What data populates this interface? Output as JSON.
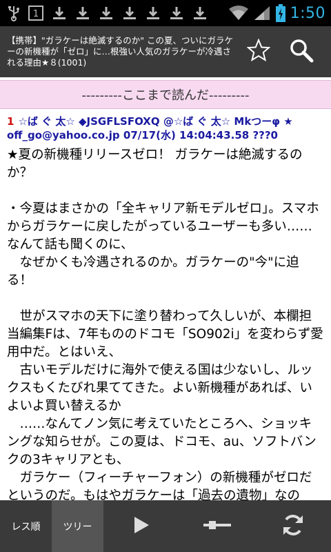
{
  "status_bar": {
    "time": "1:50",
    "notification_count": "1",
    "icons": [
      "usb-icon",
      "notification-count-icon",
      "download-icon",
      "download-icon",
      "download-icon",
      "download-icon",
      "download-icon",
      "download-icon",
      "download-icon",
      "wifi-icon",
      "signal-icon",
      "battery-icon"
    ]
  },
  "action_bar": {
    "thread_title": "【携帯】\"ガラケーは絶滅するのか\" この夏、ついにガラケーの新機種が「ゼロ」に…根強い人気のガラケーが冷遇される理由★８(1001)",
    "star_icon": "star-icon",
    "search_icon": "search-icon"
  },
  "read_marker": {
    "label": "---------ここまで読んだ---------"
  },
  "post": {
    "number": "1",
    "header": "☆ば ぐ 太☆ ◆JSGFLSFOXQ @☆ば ぐ 太☆ Mkつーφ ★ off_go@yahoo.co.jp 07/17(水) 14:04:43.58 ???0",
    "body": "★夏の新機種リリースゼロ！ ガラケーは絶滅するのか？\n\n・今夏はまさかの「全キャリア新モデルゼロ」。スマホからガラケーに戻したがっているユーザーも多い……なんて話も聞くのに、\n　なぜかくも冷遇されるのか。ガラケーの\"今\"に迫る！\n\n　世がスマホの天下に塗り替わって久しいが、本欄担当編集Fは、7年もののドコモ「SO902i」を変わらず愛用中だ。とはいえ、\n　古いモデルだけに海外で使える国は少ないし、ルックスもくたびれ果ててきた。よい新機種があれば、いよいよ買い替えるか\n　……なんてノン気に考えていたところへ、ショッキングな知らせが。この夏は、ドコモ、au、ソフトバンクの3キャリアとも、\n　ガラケー（フィーチャーフォン）の新機種がゼロだというのだ。もはやガラケーは「過去の遺物」なのか!?"
  },
  "bottom_bar": {
    "tab_res_order": "レス順",
    "tab_tree": "ツリー",
    "play_icon": "play-icon",
    "slider_icon": "slider-icon",
    "refresh_icon": "refresh-icon"
  },
  "colors": {
    "status_time": "#33b5e5",
    "action_bar_bg": "#3a3a3a",
    "read_marker_bg": "#f7d9f0",
    "post_number": "#d01010",
    "post_header": "#1a1aa0"
  }
}
